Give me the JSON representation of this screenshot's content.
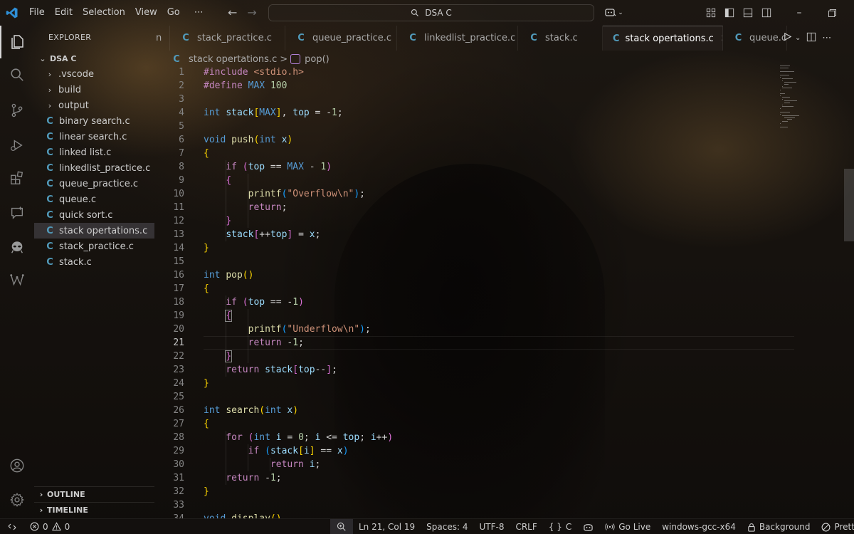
{
  "menu": [
    "File",
    "Edit",
    "Selection",
    "View",
    "Go",
    "⋯"
  ],
  "search": {
    "label": "DSA C"
  },
  "explorer": {
    "title": "EXPLORER",
    "root": "DSA C",
    "folders": [
      ".vscode",
      "build",
      "output"
    ],
    "files": [
      "binary search.c",
      "linear search.c",
      "linked list.c",
      "linkedlist_practice.c",
      "queue_practice.c",
      "queue.c",
      "quick sort.c",
      "stack opertations.c",
      "stack_practice.c",
      "stack.c"
    ],
    "selected": "stack opertations.c",
    "outline": "OUTLINE",
    "timeline": "TIMELINE"
  },
  "tabs": [
    {
      "label": "n",
      "icon": ""
    },
    {
      "label": "stack_practice.c",
      "icon": "C"
    },
    {
      "label": "queue_practice.c",
      "icon": "C"
    },
    {
      "label": "linkedlist_practice.c",
      "icon": "C"
    },
    {
      "label": "stack.c",
      "icon": "C"
    },
    {
      "label": "stack opertations.c",
      "icon": "C",
      "active": true
    },
    {
      "label": "queue.c",
      "icon": "C"
    }
  ],
  "breadcrumb": {
    "file": "stack opertations.c",
    "symbol": "pop()",
    "separator": ">"
  },
  "editor": {
    "current_line": 21,
    "lines": [
      [
        [
          "pre",
          "#include"
        ],
        [
          "txt",
          " "
        ],
        [
          "str",
          "<stdio.h>"
        ]
      ],
      [
        [
          "pre",
          "#define"
        ],
        [
          "txt",
          " "
        ],
        [
          "mac",
          "MAX"
        ],
        [
          "txt",
          " "
        ],
        [
          "num",
          "100"
        ]
      ],
      [],
      [
        [
          "kw",
          "int"
        ],
        [
          "txt",
          " "
        ],
        [
          "var",
          "stack"
        ],
        [
          "br1",
          "["
        ],
        [
          "mac",
          "MAX"
        ],
        [
          "br1",
          "]"
        ],
        [
          "txt",
          ", "
        ],
        [
          "var",
          "top"
        ],
        [
          "txt",
          " = -"
        ],
        [
          "num",
          "1"
        ],
        [
          "txt",
          ";"
        ]
      ],
      [],
      [
        [
          "kw",
          "void"
        ],
        [
          "txt",
          " "
        ],
        [
          "fn",
          "push"
        ],
        [
          "br1",
          "("
        ],
        [
          "kw",
          "int"
        ],
        [
          "txt",
          " "
        ],
        [
          "var",
          "x"
        ],
        [
          "br1",
          ")"
        ]
      ],
      [
        [
          "br1",
          "{"
        ]
      ],
      [
        [
          "txt",
          "    "
        ],
        [
          "ctl",
          "if"
        ],
        [
          "txt",
          " "
        ],
        [
          "br2",
          "("
        ],
        [
          "var",
          "top"
        ],
        [
          "txt",
          " == "
        ],
        [
          "mac",
          "MAX"
        ],
        [
          "txt",
          " - "
        ],
        [
          "num",
          "1"
        ],
        [
          "br2",
          ")"
        ]
      ],
      [
        [
          "txt",
          "    "
        ],
        [
          "br2",
          "{"
        ]
      ],
      [
        [
          "txt",
          "        "
        ],
        [
          "fn",
          "printf"
        ],
        [
          "br3",
          "("
        ],
        [
          "str",
          "\"Overflow\\n\""
        ],
        [
          "br3",
          ")"
        ],
        [
          "txt",
          ";"
        ]
      ],
      [
        [
          "txt",
          "        "
        ],
        [
          "ctl",
          "return"
        ],
        [
          "txt",
          ";"
        ]
      ],
      [
        [
          "txt",
          "    "
        ],
        [
          "br2",
          "}"
        ]
      ],
      [
        [
          "txt",
          "    "
        ],
        [
          "var",
          "stack"
        ],
        [
          "br2",
          "["
        ],
        [
          "txt",
          "++"
        ],
        [
          "var",
          "top"
        ],
        [
          "br2",
          "]"
        ],
        [
          "txt",
          " = "
        ],
        [
          "var",
          "x"
        ],
        [
          "txt",
          ";"
        ]
      ],
      [
        [
          "br1",
          "}"
        ]
      ],
      [],
      [
        [
          "kw",
          "int"
        ],
        [
          "txt",
          " "
        ],
        [
          "fn",
          "pop"
        ],
        [
          "br1",
          "()"
        ]
      ],
      [
        [
          "br1",
          "{"
        ]
      ],
      [
        [
          "txt",
          "    "
        ],
        [
          "ctl",
          "if"
        ],
        [
          "txt",
          " "
        ],
        [
          "br2",
          "("
        ],
        [
          "var",
          "top"
        ],
        [
          "txt",
          " == -"
        ],
        [
          "num",
          "1"
        ],
        [
          "br2",
          ")"
        ]
      ],
      [
        [
          "txt",
          "    "
        ],
        [
          "br2",
          "{"
        ]
      ],
      [
        [
          "txt",
          "        "
        ],
        [
          "fn",
          "printf"
        ],
        [
          "br3",
          "("
        ],
        [
          "str",
          "\"Underflow\\n\""
        ],
        [
          "br3",
          ")"
        ],
        [
          "txt",
          ";"
        ]
      ],
      [
        [
          "txt",
          "        "
        ],
        [
          "ctl",
          "return"
        ],
        [
          "txt",
          " -"
        ],
        [
          "num",
          "1"
        ],
        [
          "txt",
          ";"
        ]
      ],
      [
        [
          "txt",
          "    "
        ],
        [
          "br2",
          "}"
        ]
      ],
      [
        [
          "txt",
          "    "
        ],
        [
          "ctl",
          "return"
        ],
        [
          "txt",
          " "
        ],
        [
          "var",
          "stack"
        ],
        [
          "br2",
          "["
        ],
        [
          "var",
          "top"
        ],
        [
          "txt",
          "--"
        ],
        [
          "br2",
          "]"
        ],
        [
          "txt",
          ";"
        ]
      ],
      [
        [
          "br1",
          "}"
        ]
      ],
      [],
      [
        [
          "kw",
          "int"
        ],
        [
          "txt",
          " "
        ],
        [
          "fn",
          "search"
        ],
        [
          "br1",
          "("
        ],
        [
          "kw",
          "int"
        ],
        [
          "txt",
          " "
        ],
        [
          "var",
          "x"
        ],
        [
          "br1",
          ")"
        ]
      ],
      [
        [
          "br1",
          "{"
        ]
      ],
      [
        [
          "txt",
          "    "
        ],
        [
          "ctl",
          "for"
        ],
        [
          "txt",
          " "
        ],
        [
          "br2",
          "("
        ],
        [
          "kw",
          "int"
        ],
        [
          "txt",
          " "
        ],
        [
          "var",
          "i"
        ],
        [
          "txt",
          " = "
        ],
        [
          "num",
          "0"
        ],
        [
          "txt",
          "; "
        ],
        [
          "var",
          "i"
        ],
        [
          "txt",
          " <= "
        ],
        [
          "var",
          "top"
        ],
        [
          "txt",
          "; "
        ],
        [
          "var",
          "i"
        ],
        [
          "txt",
          "++"
        ],
        [
          "br2",
          ")"
        ]
      ],
      [
        [
          "txt",
          "        "
        ],
        [
          "ctl",
          "if"
        ],
        [
          "txt",
          " "
        ],
        [
          "br3",
          "("
        ],
        [
          "var",
          "stack"
        ],
        [
          "br1",
          "["
        ],
        [
          "var",
          "i"
        ],
        [
          "br1",
          "]"
        ],
        [
          "txt",
          " == "
        ],
        [
          "var",
          "x"
        ],
        [
          "br3",
          ")"
        ]
      ],
      [
        [
          "txt",
          "            "
        ],
        [
          "ctl",
          "return"
        ],
        [
          "txt",
          " "
        ],
        [
          "var",
          "i"
        ],
        [
          "txt",
          ";"
        ]
      ],
      [
        [
          "txt",
          "    "
        ],
        [
          "ctl",
          "return"
        ],
        [
          "txt",
          " -"
        ],
        [
          "num",
          "1"
        ],
        [
          "txt",
          ";"
        ]
      ],
      [
        [
          "br1",
          "}"
        ]
      ],
      [],
      [
        [
          "kw",
          "void"
        ],
        [
          "txt",
          " "
        ],
        [
          "fn",
          "display"
        ],
        [
          "br1",
          "()"
        ]
      ]
    ]
  },
  "status": {
    "errors": "0",
    "warnings": "0",
    "position": "Ln 21, Col 19",
    "spaces": "Spaces: 4",
    "encoding": "UTF-8",
    "eol": "CRLF",
    "language": "C",
    "golive": "Go Live",
    "config": "windows-gcc-x64",
    "background": "Background",
    "prettier": "Prettier"
  },
  "colors": {
    "accent_c": "#519aba",
    "keyword": "#569cd6",
    "control": "#c586c0",
    "function": "#dcdcaa",
    "variable": "#9cdcfe",
    "string": "#ce9178",
    "number": "#b5cea8"
  }
}
